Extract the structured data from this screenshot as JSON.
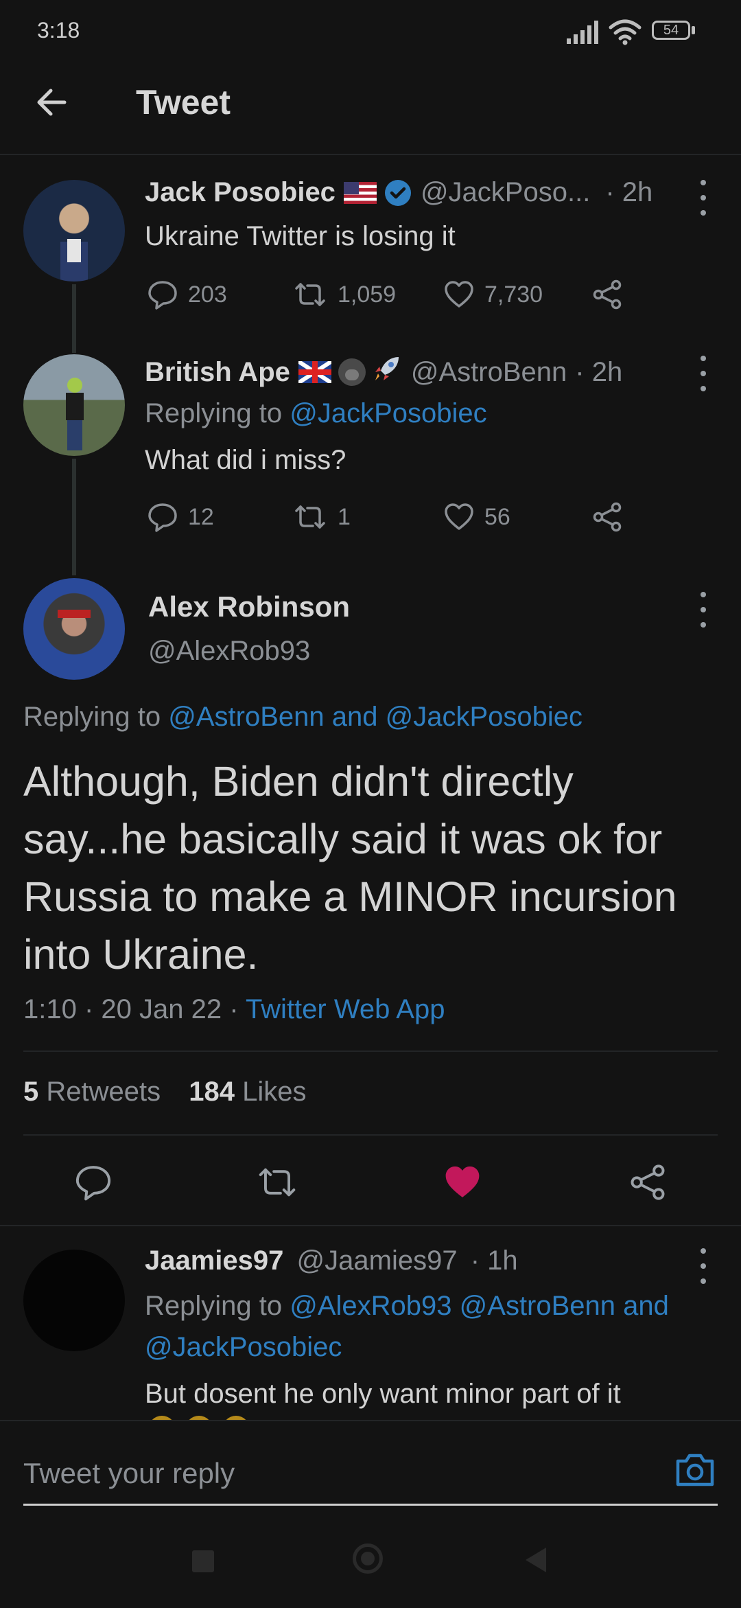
{
  "status_bar": {
    "time": "3:18",
    "battery": "54"
  },
  "header": {
    "title": "Tweet"
  },
  "tweets": [
    {
      "name": "Jack Posobiec",
      "handle": "@JackPoso...",
      "time": "· 2h",
      "text": "Ukraine Twitter is losing it",
      "replies": "203",
      "retweets": "1,059",
      "likes": "7,730"
    },
    {
      "name": "British Ape",
      "handle": "@AstroBenn",
      "time": "· 2h",
      "replying_prefix": "Replying to",
      "replying_to": "@JackPosobiec",
      "text": "What did i miss?",
      "replies": "12",
      "retweets": "1",
      "likes": "56"
    }
  ],
  "main_tweet": {
    "name": "Alex Robinson",
    "handle": "@AlexRob93",
    "replying_prefix": "Replying to",
    "replying_to": "@AstroBenn and @JackPosobiec",
    "text": "Although, Biden didn't directly say...he basically said it was ok for Russia to make a MINOR incursion into Ukraine.",
    "meta": "1:10 · 20 Jan 22 ·",
    "source": "Twitter Web App",
    "retweet_count": "5",
    "retweet_label": "Retweets",
    "like_count": "184",
    "like_label": "Likes"
  },
  "reply": {
    "name": "Jaamies97",
    "handle": "@Jaamies97",
    "time": "· 1h",
    "replying_prefix": "Replying to",
    "replying_line1": "@AlexRob93 @AstroBenn and",
    "replying_line2": "@JackPosobiec",
    "text": "But dosent he only want minor part of it"
  },
  "composer": {
    "placeholder": "Tweet your reply"
  },
  "colors": {
    "accent": "#2f7fc1",
    "like": "#c2185b",
    "background": "#131313"
  },
  "icons": [
    "back-arrow-icon",
    "verified-icon",
    "reply-icon",
    "retweet-icon",
    "like-icon",
    "share-icon",
    "camera-icon",
    "more-icon"
  ]
}
